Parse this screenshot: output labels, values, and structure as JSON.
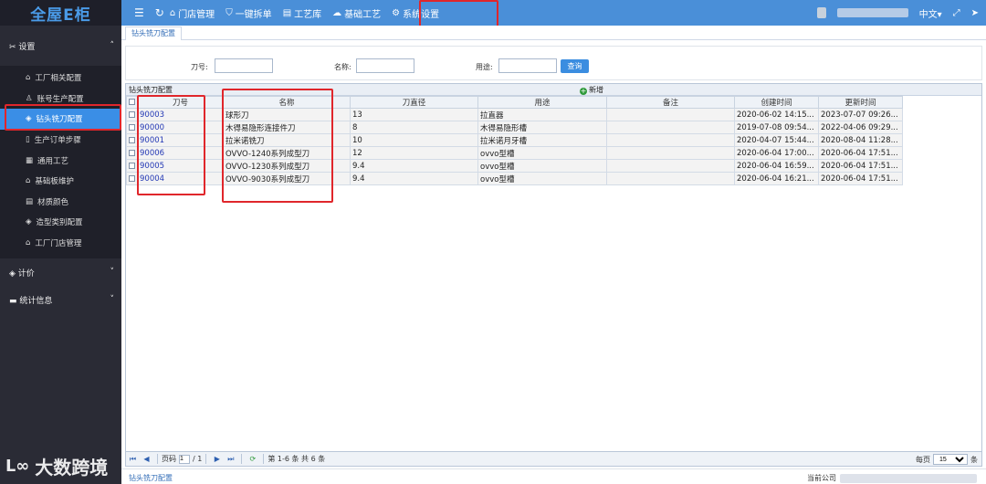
{
  "app": {
    "logo_text": "全屋E柜"
  },
  "topnav": {
    "menu_icon": "☰",
    "refresh_icon": "↻",
    "items": [
      {
        "label": "门店管理",
        "icon": "⌂"
      },
      {
        "label": "一键拆单",
        "icon": "⛉"
      },
      {
        "label": "工艺库",
        "icon": "▤"
      },
      {
        "label": "基础工艺",
        "icon": "☁"
      },
      {
        "label": "系统设置",
        "icon": "⚙"
      }
    ],
    "lang": "中文▾"
  },
  "sidebar": {
    "settings_group": "设置",
    "items": [
      {
        "label": "工厂相关配置",
        "icon": "⌂"
      },
      {
        "label": "账号生产配置",
        "icon": "♙"
      },
      {
        "label": "钻头铣刀配置",
        "icon": "◈"
      },
      {
        "label": "生产订单步骤",
        "icon": "▯"
      },
      {
        "label": "通用工艺",
        "icon": "▦"
      },
      {
        "label": "基础板维护",
        "icon": "⌂"
      },
      {
        "label": "材质颜色",
        "icon": "▤"
      },
      {
        "label": "造型类别配置",
        "icon": "◈"
      },
      {
        "label": "工厂门店管理",
        "icon": "⌂"
      }
    ],
    "pricing_group": "计价",
    "stats_group": "统计信息"
  },
  "tab": {
    "label": "钻头铣刀配置"
  },
  "search": {
    "code_label": "刀号:",
    "name_label": "名称:",
    "usage_label": "用途:",
    "query_button": "查询"
  },
  "grid": {
    "title": "钻头铣刀配置",
    "add_label": "新增",
    "columns": [
      "刀号",
      "名称",
      "刀直径",
      "用途",
      "备注",
      "创建时间",
      "更新时间"
    ],
    "rows": [
      [
        "90003",
        "球形刀",
        "13",
        "拉直器",
        "",
        "2020-06-02 14:15...",
        "2023-07-07 09:26..."
      ],
      [
        "90000",
        "木得易隐形连接件刀",
        "8",
        "木得易隐形槽",
        "",
        "2019-07-08 09:54...",
        "2022-04-06 09:29..."
      ],
      [
        "90001",
        "拉米诺铣刀",
        "10",
        "拉米诺月牙槽",
        "",
        "2020-04-07 15:44...",
        "2020-08-04 11:28..."
      ],
      [
        "90006",
        "OVVO-1240系列成型刀",
        "12",
        "ovvo型槽",
        "",
        "2020-06-04 17:00...",
        "2020-06-04 17:51..."
      ],
      [
        "90005",
        "OVVO-1230系列成型刀",
        "9.4",
        "ovvo型槽",
        "",
        "2020-06-04 16:59...",
        "2020-06-04 17:51..."
      ],
      [
        "90004",
        "OVVO-9030系列成型刀",
        "9.4",
        "ovvo型槽",
        "",
        "2020-06-04 16:21...",
        "2020-06-04 17:51..."
      ]
    ]
  },
  "pager": {
    "page_label": "页码",
    "page_value": "1",
    "total_pages": "/ 1",
    "summary": "第 1-6 条  共 6 条",
    "per_page_label": "每页",
    "per_page_value": "15",
    "unit": "条"
  },
  "footer": {
    "left": "钻头铣刀配置",
    "right_label": "当前公司"
  },
  "watermark": {
    "text": "大数跨境"
  }
}
